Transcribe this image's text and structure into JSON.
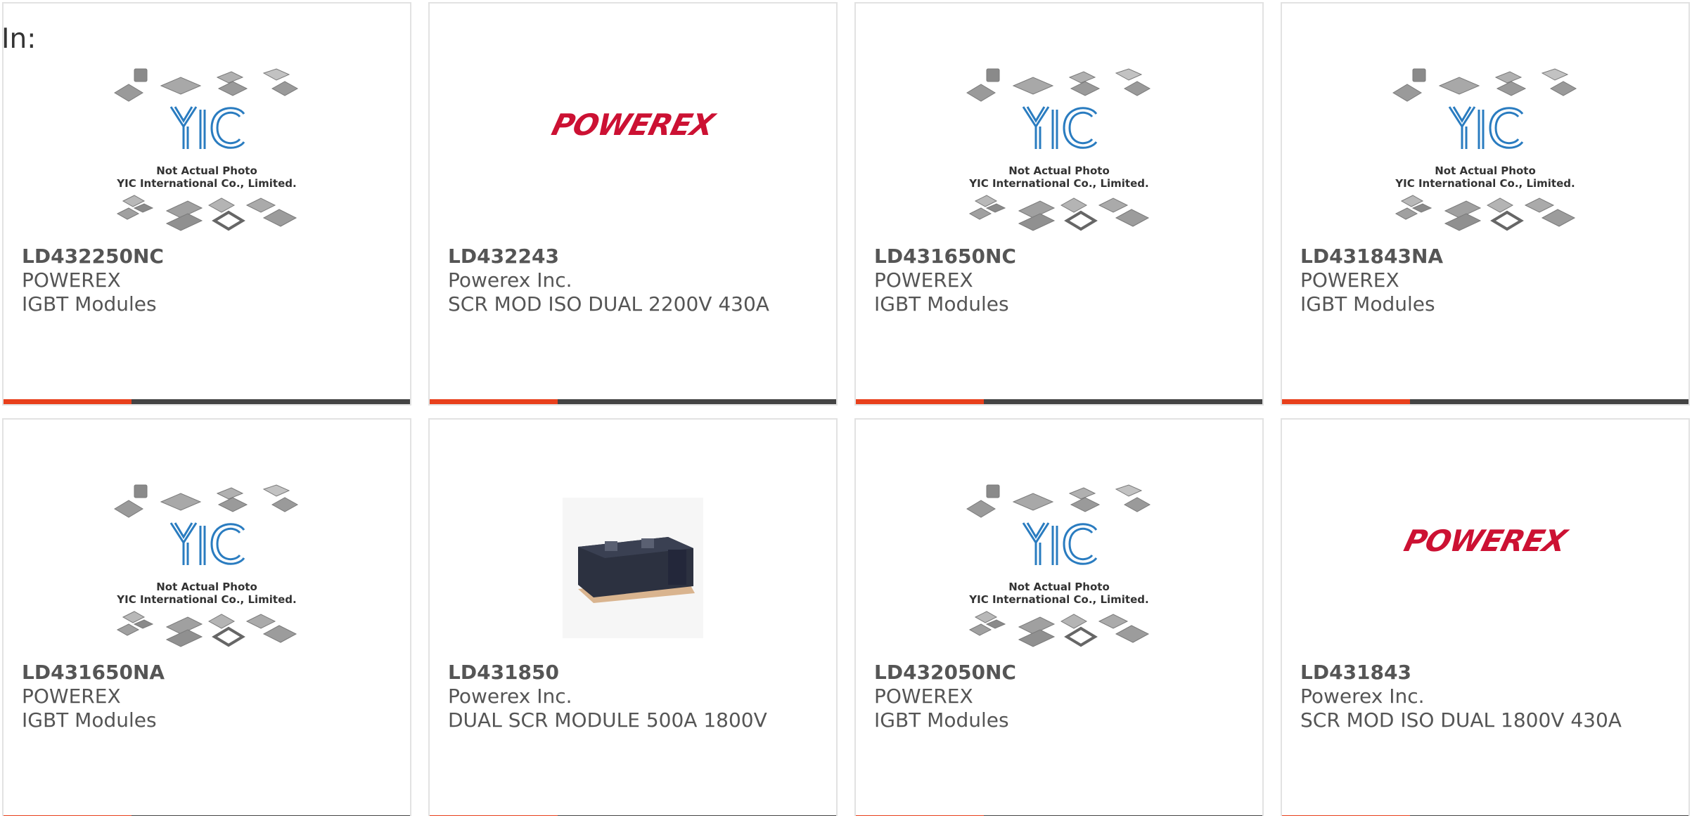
{
  "header": {
    "label": "In:"
  },
  "brand": {
    "accent_color": "#e8401c",
    "bar_color": "#444444"
  },
  "placeholder": {
    "line1": "Not Actual Photo",
    "line2": "YIC International Co., Limited.",
    "logo": "YIC"
  },
  "powerex_logo": "POWEREX",
  "products": [
    {
      "part_no": "LD432250NC",
      "manufacturer": "POWEREX",
      "description": "IGBT Modules",
      "image": "placeholder"
    },
    {
      "part_no": "LD432243",
      "manufacturer": "Powerex Inc.",
      "description": "SCR MOD ISO DUAL 2200V 430A",
      "image": "powerex-logo"
    },
    {
      "part_no": "LD431650NC",
      "manufacturer": "POWEREX",
      "description": "IGBT Modules",
      "image": "placeholder"
    },
    {
      "part_no": "LD431843NA",
      "manufacturer": "POWEREX",
      "description": "IGBT Modules",
      "image": "placeholder"
    },
    {
      "part_no": "LD431650NA",
      "manufacturer": "POWEREX",
      "description": "IGBT Modules",
      "image": "placeholder"
    },
    {
      "part_no": "LD431850",
      "manufacturer": "Powerex Inc.",
      "description": "DUAL SCR MODULE 500A 1800V",
      "image": "module-photo"
    },
    {
      "part_no": "LD432050NC",
      "manufacturer": "POWEREX",
      "description": "IGBT Modules",
      "image": "placeholder"
    },
    {
      "part_no": "LD431843",
      "manufacturer": "Powerex Inc.",
      "description": "SCR MOD ISO DUAL 1800V 430A",
      "image": "powerex-logo"
    }
  ]
}
